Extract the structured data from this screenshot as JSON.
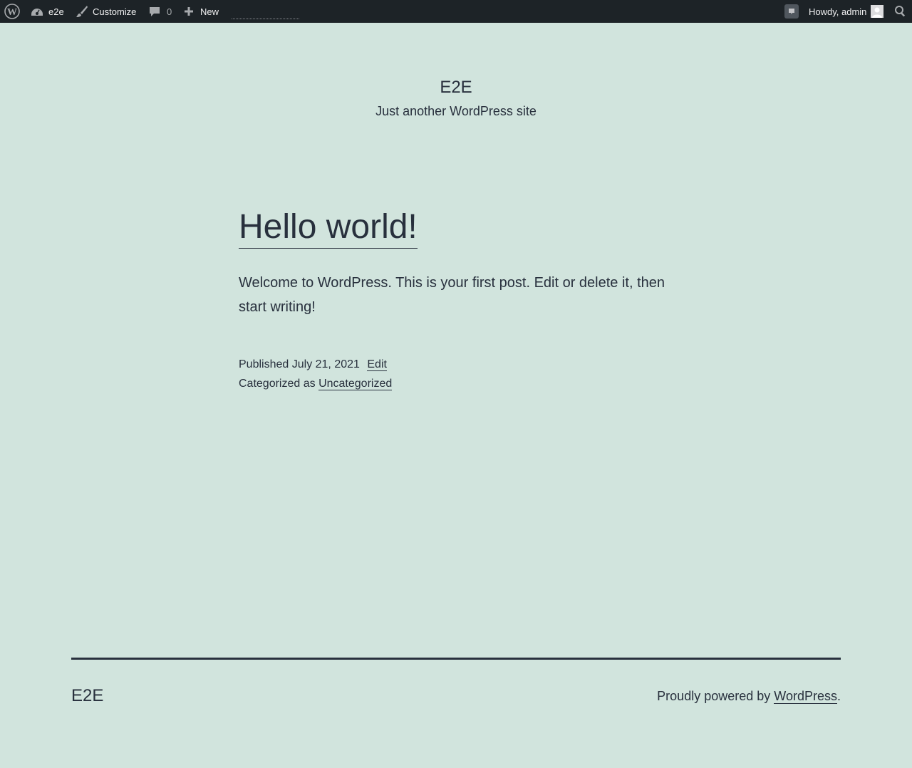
{
  "admin_bar": {
    "site_name": "e2e",
    "customize_label": "Customize",
    "comments_count": "0",
    "new_label": "New",
    "greeting": "Howdy, admin",
    "icons": {
      "wordpress": "wordpress-logo-icon",
      "dashboard": "dashboard-icon",
      "customize": "paintbrush-icon",
      "comments": "comment-bubble-icon",
      "new": "plus-icon",
      "notification": "notification-icon",
      "avatar": "avatar-icon",
      "search": "search-icon"
    }
  },
  "header": {
    "site_title": "E2E",
    "tagline": "Just another WordPress site"
  },
  "post": {
    "title": "Hello world!",
    "content": "Welcome to WordPress. This is your first post. Edit or delete it, then start writing!",
    "published_label": "Published",
    "published_date": "July 21, 2021",
    "edit_label": "Edit",
    "categorized_label": "Categorized as",
    "category": "Uncategorized"
  },
  "footer": {
    "site_title": "E2E",
    "powered_prefix": "Proudly powered by",
    "powered_link": "WordPress",
    "powered_suffix": "."
  },
  "colors": {
    "background": "#d1e4dd",
    "text": "#28303d",
    "admin_bar": "#1d2327"
  }
}
